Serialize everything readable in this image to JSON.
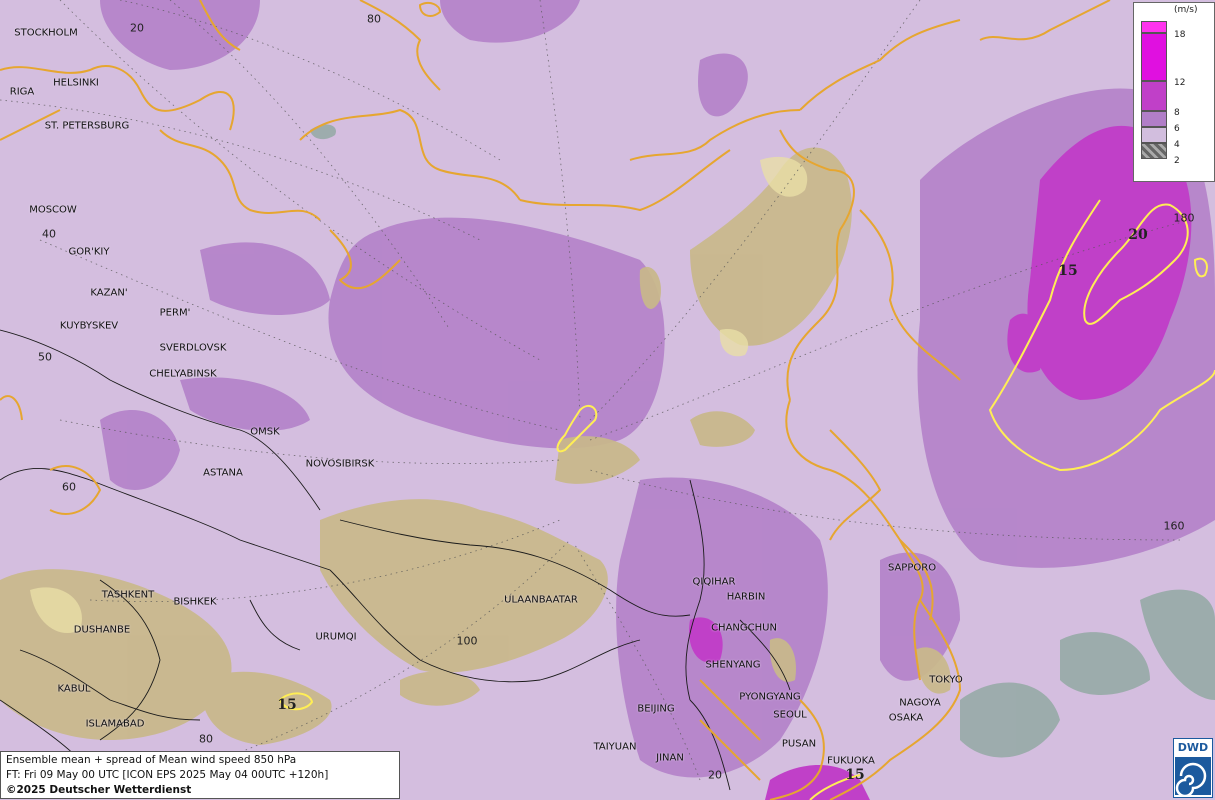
{
  "map": {
    "legend": {
      "unit": "(m/s)",
      "levels": [
        {
          "label": "18",
          "color": "#ff33ee"
        },
        {
          "label": "12",
          "color": "#e010e0"
        },
        {
          "label": "8",
          "color": "#c040c8"
        },
        {
          "label": "6",
          "color": "#b17ec8"
        },
        {
          "label": "4",
          "color": "#d2bede"
        },
        {
          "label": "2",
          "color": "#888888"
        }
      ]
    },
    "cities": [
      {
        "label": "STOCKHOLM"
      },
      {
        "label": "HELSINKI"
      },
      {
        "label": "RIGA"
      },
      {
        "label": "ST. PETERSBURG"
      },
      {
        "label": "MOSCOW"
      },
      {
        "label": "GOR'KIY"
      },
      {
        "label": "KAZAN'"
      },
      {
        "label": "PERM'"
      },
      {
        "label": "KUYBYSKEV"
      },
      {
        "label": "SVERDLOVSK"
      },
      {
        "label": "CHELYABINSK"
      },
      {
        "label": "OMSK"
      },
      {
        "label": "ASTANA"
      },
      {
        "label": "NOVOSIBIRSK"
      },
      {
        "label": "TASHKENT"
      },
      {
        "label": "BISHKEK"
      },
      {
        "label": "DUSHANBE"
      },
      {
        "label": "URUMQI"
      },
      {
        "label": "KABUL"
      },
      {
        "label": "ISLAMABAD"
      },
      {
        "label": "ULAANBAATAR"
      },
      {
        "label": "QIQIHAR"
      },
      {
        "label": "HARBIN"
      },
      {
        "label": "CHANGCHUN"
      },
      {
        "label": "SHENYANG"
      },
      {
        "label": "PYONGYANG"
      },
      {
        "label": "SEOUL"
      },
      {
        "label": "BEIJING"
      },
      {
        "label": "TAIYUAN"
      },
      {
        "label": "JINAN"
      },
      {
        "label": "PUSAN"
      },
      {
        "label": "FUKUOKA"
      },
      {
        "label": "OSAKA"
      },
      {
        "label": "NAGOYA"
      },
      {
        "label": "TOKYO"
      },
      {
        "label": "SAPPORO"
      }
    ],
    "grid_labels": [
      {
        "label": "20"
      },
      {
        "label": "80"
      },
      {
        "label": "40"
      },
      {
        "label": "50"
      },
      {
        "label": "60"
      },
      {
        "label": "100"
      },
      {
        "label": "80"
      },
      {
        "label": "180"
      },
      {
        "label": "160"
      },
      {
        "label": "20"
      }
    ],
    "contour_labels": [
      {
        "label": "15"
      },
      {
        "label": "20"
      },
      {
        "label": "15"
      },
      {
        "label": "15"
      }
    ],
    "info": {
      "line1": "Ensemble mean + spread of Mean wind speed 850 hPa",
      "line2": "FT: Fri 09 May 00 UTC [ICON EPS 2025 May 04 00UTC +120h]",
      "copyright": "©2025 Deutscher Wetterdienst"
    },
    "logo_text": "DWD",
    "colors": {
      "base": "#d4bedf",
      "mid": "#b17ec8",
      "high": "#c040c8",
      "very_high": "#e010e0",
      "terrain": "#c9b88a",
      "coast": "#e6a630",
      "contour": "#ffee55"
    }
  }
}
